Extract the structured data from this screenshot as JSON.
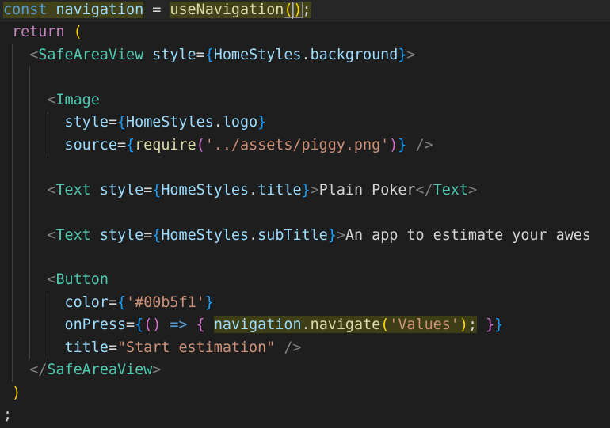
{
  "colors": {
    "background": "#1e1e1e",
    "plain": "#d4d4d4",
    "keyword_storage": "#569cd6",
    "keyword_control": "#c586c0",
    "variable": "#9cdcfe",
    "function": "#dcdcaa",
    "tag": "#4ec9b0",
    "tag_bracket": "#808080",
    "attribute": "#9cdcfe",
    "string": "#ce9178",
    "brace_gold": "#ffd700",
    "brace_blue": "#179fff",
    "brace_purple": "#da70d6",
    "selection_highlight": "#6b6b10"
  },
  "code": {
    "lines": [
      {
        "name": "line-const-navigation",
        "active": true,
        "tokens": [
          {
            "t": "const",
            "c": "keyword_storage",
            "hl": true
          },
          {
            "t": " ",
            "c": "plain",
            "hl": true
          },
          {
            "t": "navigation",
            "c": "variable",
            "hl": true
          },
          {
            "t": " = ",
            "c": "plain"
          },
          {
            "t": "useNavigation",
            "c": "function",
            "hl": true
          },
          {
            "t": "(",
            "c": "brace_gold",
            "hl": true,
            "bm": true
          },
          {
            "cursor": true
          },
          {
            "t": ")",
            "c": "brace_gold",
            "hl": true,
            "bm": true
          },
          {
            "t": ";",
            "c": "plain",
            "hl": true
          }
        ]
      },
      {
        "name": "line-return",
        "tokens": [
          {
            "t": " ",
            "c": "plain"
          },
          {
            "t": "return",
            "c": "keyword_control"
          },
          {
            "t": " ",
            "c": "plain"
          },
          {
            "t": "(",
            "c": "brace_gold"
          }
        ]
      },
      {
        "name": "line-safeareaview-open",
        "tokens": [
          {
            "t": "   ",
            "c": "plain"
          },
          {
            "t": "<",
            "c": "tag_bracket"
          },
          {
            "t": "SafeAreaView",
            "c": "tag"
          },
          {
            "t": " ",
            "c": "plain"
          },
          {
            "t": "style",
            "c": "attribute"
          },
          {
            "t": "=",
            "c": "plain"
          },
          {
            "t": "{",
            "c": "brace_blue"
          },
          {
            "t": "HomeStyles",
            "c": "variable"
          },
          {
            "t": ".",
            "c": "plain"
          },
          {
            "t": "background",
            "c": "variable"
          },
          {
            "t": "}",
            "c": "brace_blue"
          },
          {
            "t": ">",
            "c": "tag_bracket"
          }
        ]
      },
      {
        "name": "line-blank-1",
        "tokens": []
      },
      {
        "name": "line-image-open",
        "tokens": [
          {
            "t": "     ",
            "c": "plain"
          },
          {
            "t": "<",
            "c": "tag_bracket"
          },
          {
            "t": "Image",
            "c": "tag"
          }
        ]
      },
      {
        "name": "line-image-style",
        "tokens": [
          {
            "t": "       ",
            "c": "plain"
          },
          {
            "t": "style",
            "c": "attribute"
          },
          {
            "t": "=",
            "c": "plain"
          },
          {
            "t": "{",
            "c": "brace_blue"
          },
          {
            "t": "HomeStyles",
            "c": "variable"
          },
          {
            "t": ".",
            "c": "plain"
          },
          {
            "t": "logo",
            "c": "variable"
          },
          {
            "t": "}",
            "c": "brace_blue"
          }
        ]
      },
      {
        "name": "line-image-source",
        "tokens": [
          {
            "t": "       ",
            "c": "plain"
          },
          {
            "t": "source",
            "c": "attribute"
          },
          {
            "t": "=",
            "c": "plain"
          },
          {
            "t": "{",
            "c": "brace_blue"
          },
          {
            "t": "require",
            "c": "function"
          },
          {
            "t": "(",
            "c": "brace_purple"
          },
          {
            "t": "'../assets/piggy.png'",
            "c": "string"
          },
          {
            "t": ")",
            "c": "brace_purple"
          },
          {
            "t": "}",
            "c": "brace_blue"
          },
          {
            "t": " ",
            "c": "plain"
          },
          {
            "t": "/>",
            "c": "tag_bracket"
          }
        ]
      },
      {
        "name": "line-blank-2",
        "tokens": []
      },
      {
        "name": "line-text-title",
        "tokens": [
          {
            "t": "     ",
            "c": "plain"
          },
          {
            "t": "<",
            "c": "tag_bracket"
          },
          {
            "t": "Text",
            "c": "tag"
          },
          {
            "t": " ",
            "c": "plain"
          },
          {
            "t": "style",
            "c": "attribute"
          },
          {
            "t": "=",
            "c": "plain"
          },
          {
            "t": "{",
            "c": "brace_blue"
          },
          {
            "t": "HomeStyles",
            "c": "variable"
          },
          {
            "t": ".",
            "c": "plain"
          },
          {
            "t": "title",
            "c": "variable"
          },
          {
            "t": "}",
            "c": "brace_blue"
          },
          {
            "t": ">",
            "c": "tag_bracket"
          },
          {
            "t": "Plain Poker",
            "c": "plain"
          },
          {
            "t": "</",
            "c": "tag_bracket"
          },
          {
            "t": "Text",
            "c": "tag"
          },
          {
            "t": ">",
            "c": "tag_bracket"
          }
        ]
      },
      {
        "name": "line-blank-3",
        "tokens": []
      },
      {
        "name": "line-text-subtitle",
        "tokens": [
          {
            "t": "     ",
            "c": "plain"
          },
          {
            "t": "<",
            "c": "tag_bracket"
          },
          {
            "t": "Text",
            "c": "tag"
          },
          {
            "t": " ",
            "c": "plain"
          },
          {
            "t": "style",
            "c": "attribute"
          },
          {
            "t": "=",
            "c": "plain"
          },
          {
            "t": "{",
            "c": "brace_blue"
          },
          {
            "t": "HomeStyles",
            "c": "variable"
          },
          {
            "t": ".",
            "c": "plain"
          },
          {
            "t": "subTitle",
            "c": "variable"
          },
          {
            "t": "}",
            "c": "brace_blue"
          },
          {
            "t": ">",
            "c": "tag_bracket"
          },
          {
            "t": "An app to estimate your awes",
            "c": "plain"
          }
        ]
      },
      {
        "name": "line-blank-4",
        "tokens": []
      },
      {
        "name": "line-button-open",
        "tokens": [
          {
            "t": "     ",
            "c": "plain"
          },
          {
            "t": "<",
            "c": "tag_bracket"
          },
          {
            "t": "Button",
            "c": "tag"
          }
        ]
      },
      {
        "name": "line-button-color",
        "tokens": [
          {
            "t": "       ",
            "c": "plain"
          },
          {
            "t": "color",
            "c": "attribute"
          },
          {
            "t": "=",
            "c": "plain"
          },
          {
            "t": "{",
            "c": "brace_blue"
          },
          {
            "t": "'#00b5f1'",
            "c": "string"
          },
          {
            "t": "}",
            "c": "brace_blue"
          }
        ]
      },
      {
        "name": "line-button-onpress",
        "tokens": [
          {
            "t": "       ",
            "c": "plain"
          },
          {
            "t": "onPress",
            "c": "attribute"
          },
          {
            "t": "=",
            "c": "plain"
          },
          {
            "t": "{",
            "c": "brace_blue"
          },
          {
            "t": "()",
            "c": "brace_purple"
          },
          {
            "t": " ",
            "c": "plain"
          },
          {
            "t": "=>",
            "c": "keyword_storage"
          },
          {
            "t": " ",
            "c": "plain"
          },
          {
            "t": "{",
            "c": "brace_purple"
          },
          {
            "t": " ",
            "c": "plain"
          },
          {
            "t": "navigation",
            "c": "variable",
            "hl": true
          },
          {
            "t": ".",
            "c": "plain",
            "hl": true
          },
          {
            "t": "navigate",
            "c": "function",
            "hl": true
          },
          {
            "t": "(",
            "c": "brace_gold",
            "hl": true
          },
          {
            "t": "'Values'",
            "c": "string",
            "hl": true
          },
          {
            "t": ")",
            "c": "brace_gold",
            "hl": true
          },
          {
            "t": ";",
            "c": "plain",
            "hl": true
          },
          {
            "t": " ",
            "c": "plain"
          },
          {
            "t": "}",
            "c": "brace_purple"
          },
          {
            "t": "}",
            "c": "brace_blue"
          }
        ]
      },
      {
        "name": "line-button-title",
        "tokens": [
          {
            "t": "       ",
            "c": "plain"
          },
          {
            "t": "title",
            "c": "attribute"
          },
          {
            "t": "=",
            "c": "plain"
          },
          {
            "t": "\"Start estimation\"",
            "c": "string"
          },
          {
            "t": " ",
            "c": "plain"
          },
          {
            "t": "/>",
            "c": "tag_bracket"
          }
        ]
      },
      {
        "name": "line-safeareaview-close",
        "tokens": [
          {
            "t": "   ",
            "c": "plain"
          },
          {
            "t": "</",
            "c": "tag_bracket"
          },
          {
            "t": "SafeAreaView",
            "c": "tag"
          },
          {
            "t": ">",
            "c": "tag_bracket"
          }
        ]
      },
      {
        "name": "line-close-paren",
        "tokens": [
          {
            "t": " ",
            "c": "plain"
          },
          {
            "t": ")",
            "c": "brace_gold"
          }
        ]
      },
      {
        "name": "line-semicolon",
        "tokens": [
          {
            "t": ";",
            "c": "plain"
          }
        ]
      }
    ]
  }
}
